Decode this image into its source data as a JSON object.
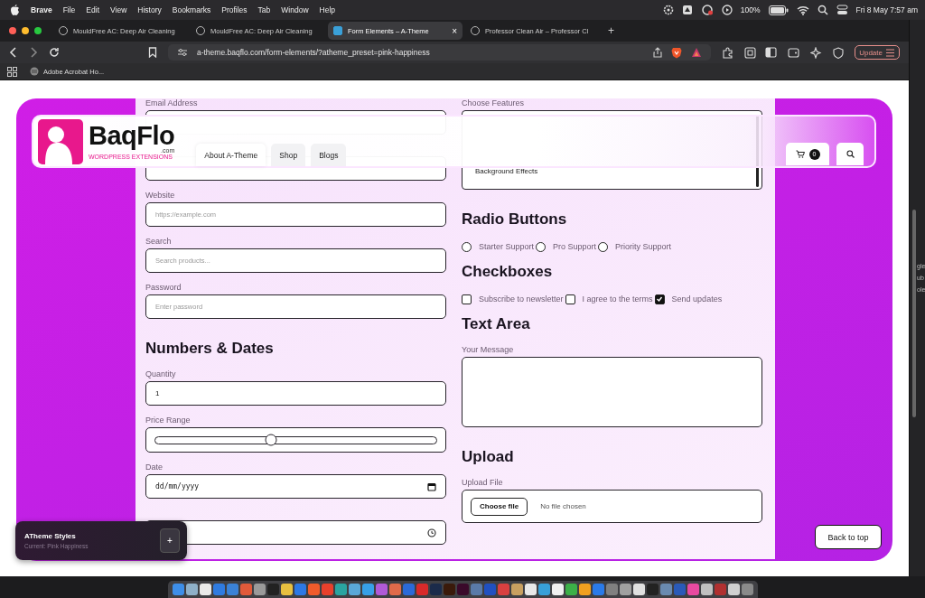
{
  "menubar": {
    "app": "Brave",
    "items": [
      "File",
      "Edit",
      "View",
      "History",
      "Bookmarks",
      "Profiles",
      "Tab",
      "Window",
      "Help"
    ],
    "battery": "100%",
    "clock": "Fri 8 May  7:57 am"
  },
  "tabs": [
    {
      "title": "MouldFree AC: Deep Air Cleaning",
      "selected": false
    },
    {
      "title": "MouldFree AC: Deep Air Cleaning",
      "selected": false
    },
    {
      "title": "Form Elements – A-Theme",
      "selected": true
    },
    {
      "title": "Professor Clean Air – Professor Cl",
      "selected": false
    }
  ],
  "tab_close": "×",
  "new_tab": "+",
  "address_bar": {
    "url": "a-theme.baqflo.com/form-elements/?atheme_preset=pink-happiness"
  },
  "update_button": "Update",
  "bookmarks": [
    "Adobe Acrobat Ho..."
  ],
  "site_header": {
    "logo_name": "BaqFlo",
    "logo_domain": ".com",
    "logo_tagline": "WORDPRESS EXTENSIONS",
    "nav": [
      {
        "label": "About A-Theme",
        "selected": true
      },
      {
        "label": "Shop",
        "selected": false
      },
      {
        "label": "Blogs",
        "selected": false
      }
    ],
    "cart_count": "0"
  },
  "form": {
    "left": [
      {
        "kind": "field",
        "label": "Email Address"
      },
      {
        "kind": "field"
      },
      {
        "kind": "field",
        "label": "Website",
        "placeholder": "https://example.com"
      },
      {
        "kind": "field",
        "label": "Search",
        "placeholder": "Search products..."
      },
      {
        "kind": "field",
        "label": "Password",
        "placeholder": "Enter password"
      },
      {
        "kind": "heading",
        "text": "Numbers & Dates"
      },
      {
        "kind": "field",
        "label": "Quantity",
        "value": "1"
      },
      {
        "kind": "range",
        "label": "Price Range",
        "level": 0.41
      },
      {
        "kind": "date",
        "label": "Date",
        "placeholder": "dd/mm/yyyy"
      },
      {
        "kind": "time"
      }
    ],
    "right": [
      {
        "kind": "listbox",
        "label": "Choose Features",
        "options": [
          "Background Effects"
        ]
      },
      {
        "kind": "heading",
        "text": "Radio Buttons"
      },
      {
        "kind": "radios",
        "options": [
          {
            "label": "Starter Support",
            "selected": false
          },
          {
            "label": "Pro Support",
            "selected": false
          },
          {
            "label": "Priority Support",
            "selected": false
          }
        ]
      },
      {
        "kind": "heading",
        "text": "Checkboxes"
      },
      {
        "kind": "checkboxes",
        "options": [
          {
            "label": "Subscribe to newsletter",
            "checked": false
          },
          {
            "label": "I agree to the terms",
            "checked": false
          },
          {
            "label": "Send updates",
            "checked": true
          }
        ]
      },
      {
        "kind": "heading",
        "text": "Text Area"
      },
      {
        "kind": "textarea",
        "label": "Your Message"
      },
      {
        "kind": "heading",
        "text": "Upload"
      },
      {
        "kind": "file",
        "label": "Upload File",
        "button": "Choose file",
        "status": "No file chosen"
      }
    ]
  },
  "styles_panel": {
    "title": "ATheme Styles",
    "subtitle": "Current: Pink Happiness",
    "button": "+"
  },
  "back_to_top": "Back to top",
  "background_window": {
    "lines": [
      "gle",
      "ub",
      "ole"
    ]
  }
}
